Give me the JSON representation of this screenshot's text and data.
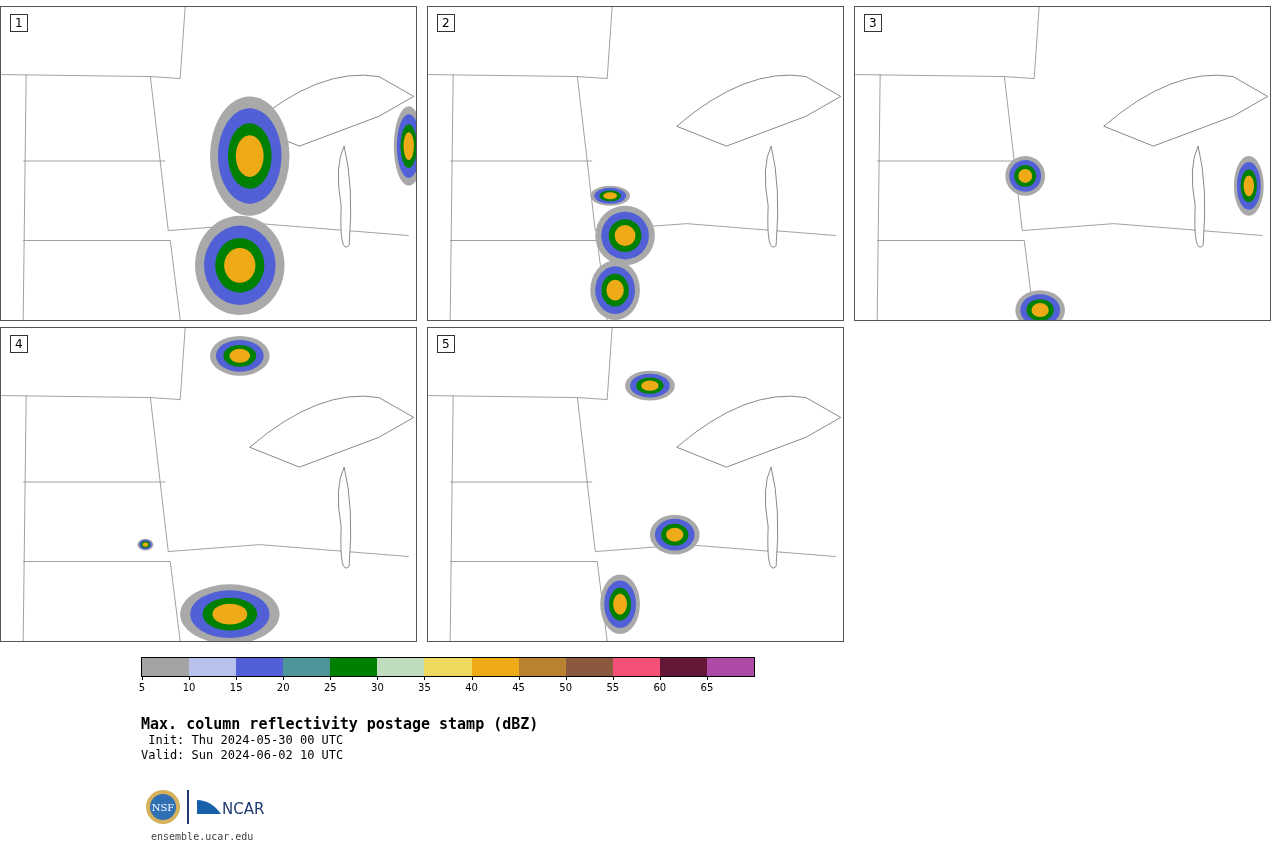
{
  "panels": [
    {
      "label": "1"
    },
    {
      "label": "2"
    },
    {
      "label": "3"
    },
    {
      "label": "4"
    },
    {
      "label": "5"
    }
  ],
  "colorbar": {
    "segments": [
      {
        "color": "#a3a3a3",
        "tick": "5"
      },
      {
        "color": "#b7c1ec",
        "tick": "10"
      },
      {
        "color": "#5160d6",
        "tick": "15"
      },
      {
        "color": "#4e9599",
        "tick": "20"
      },
      {
        "color": "#008000",
        "tick": "25"
      },
      {
        "color": "#bfdcbf",
        "tick": "30"
      },
      {
        "color": "#efd95f",
        "tick": "35"
      },
      {
        "color": "#eeab17",
        "tick": "40"
      },
      {
        "color": "#b98230",
        "tick": "45"
      },
      {
        "color": "#8b5a3e",
        "tick": "50"
      },
      {
        "color": "#f45078",
        "tick": "55"
      },
      {
        "color": "#641737",
        "tick": "60"
      },
      {
        "color": "#ad4aa5",
        "tick": "65"
      }
    ]
  },
  "title": "Max. column reflectivity postage stamp (dBZ)",
  "init": " Init: Thu 2024-05-30 00 UTC",
  "valid": "Valid: Sun 2024-06-02 10 UTC",
  "logos": {
    "seal": "NSF",
    "wordmark": "NCAR"
  },
  "footer": "ensemble.ucar.edu"
}
